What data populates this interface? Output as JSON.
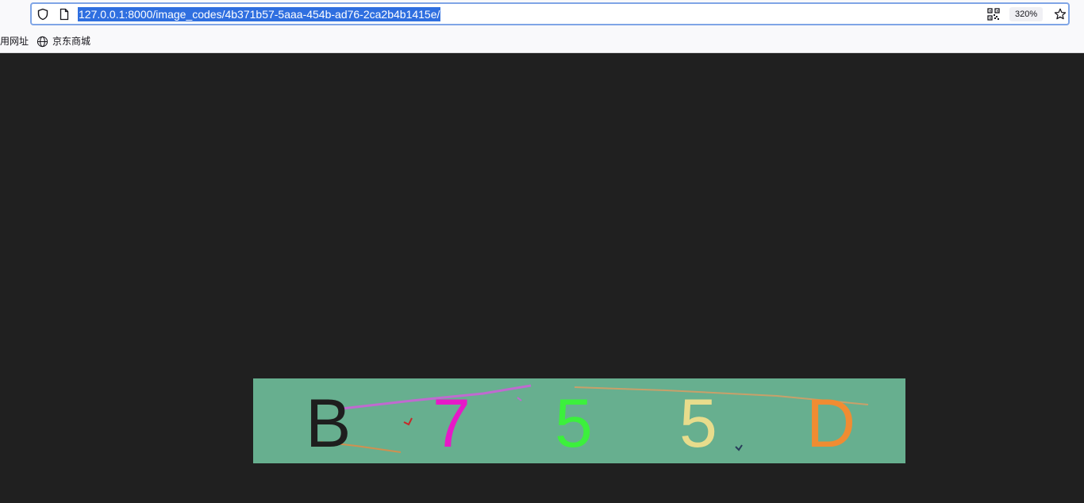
{
  "url_bar": {
    "url": "127.0.0.1:8000/image_codes/4b371b57-5aaa-454b-ad76-2ca2b4b1415e/",
    "zoom": "320%"
  },
  "bookmarks": [
    {
      "label": "用网址"
    },
    {
      "label": "京东商城"
    }
  ],
  "captcha": {
    "characters": [
      {
        "char": "B",
        "color": "#1e1e1e"
      },
      {
        "char": "7",
        "color": "#e619c8"
      },
      {
        "char": "5",
        "color": "#3cf03c"
      },
      {
        "char": "5",
        "color": "#e8dc8c"
      },
      {
        "char": "D",
        "color": "#f08c32"
      }
    ],
    "background": "#67af8f",
    "noise_line_colors": [
      "#c06ad0",
      "#c8a06a",
      "#d09050"
    ]
  }
}
